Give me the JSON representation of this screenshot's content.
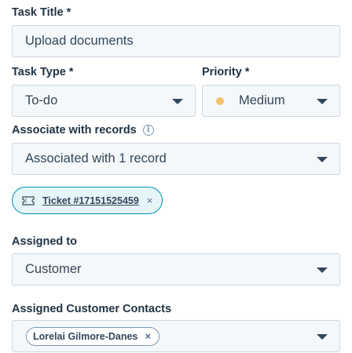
{
  "task_title": {
    "label": "Task Title *",
    "value": "Upload documents"
  },
  "task_type": {
    "label": "Task Type *",
    "value": "To-do"
  },
  "priority": {
    "label": "Priority *",
    "value": "Medium",
    "dot_color": "#f5c26b"
  },
  "associate": {
    "label": "Associate with records",
    "info_glyph": "i",
    "value": "Associated with 1 record",
    "chip_label": "Ticket #17151525459",
    "chip_icon": "ticket-icon",
    "chip_remove": "×"
  },
  "assigned_to": {
    "label": "Assigned to",
    "value": "Customer"
  },
  "contacts": {
    "label": "Assigned Customer Contacts",
    "chip_label": "Lorelai Gilmore-Danes",
    "chip_remove": "×"
  },
  "colors": {
    "border": "#cbd6e2",
    "field_bg": "#f5f8fa",
    "label": "#213343",
    "text": "#33475b",
    "chip_accent": "#0091ae",
    "chip_bg": "#e5f5f8"
  }
}
